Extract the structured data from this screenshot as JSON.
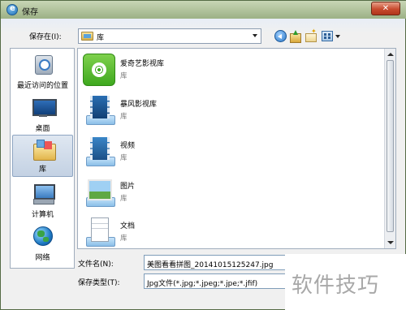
{
  "window": {
    "title": "保存",
    "close_label": "✕"
  },
  "save_in": {
    "label": "保存在(I):",
    "value": "库"
  },
  "places": [
    {
      "label": "最近访问的位置",
      "icon": "recent-places-icon"
    },
    {
      "label": "桌面",
      "icon": "desktop-icon"
    },
    {
      "label": "库",
      "icon": "library-icon",
      "selected": true
    },
    {
      "label": "计算机",
      "icon": "computer-icon"
    },
    {
      "label": "网络",
      "icon": "network-icon"
    }
  ],
  "items": [
    {
      "name": "爱奇艺影视库",
      "type": "库",
      "icon": "iqiyi-icon"
    },
    {
      "name": "暴风影视库",
      "type": "库",
      "icon": "film-library-icon"
    },
    {
      "name": "视频",
      "type": "库",
      "icon": "video-library-icon"
    },
    {
      "name": "图片",
      "type": "库",
      "icon": "pictures-library-icon"
    },
    {
      "name": "文档",
      "type": "库",
      "icon": "documents-library-icon"
    }
  ],
  "file_name": {
    "label": "文件名(N):",
    "value": "美图看看拼图_20141015125247.jpg"
  },
  "file_type": {
    "label": "保存类型(T):",
    "value": "Jpg文件(*.jpg;*.jpeg;*.jpe;*.jfif)"
  },
  "watermark": "软件技巧"
}
